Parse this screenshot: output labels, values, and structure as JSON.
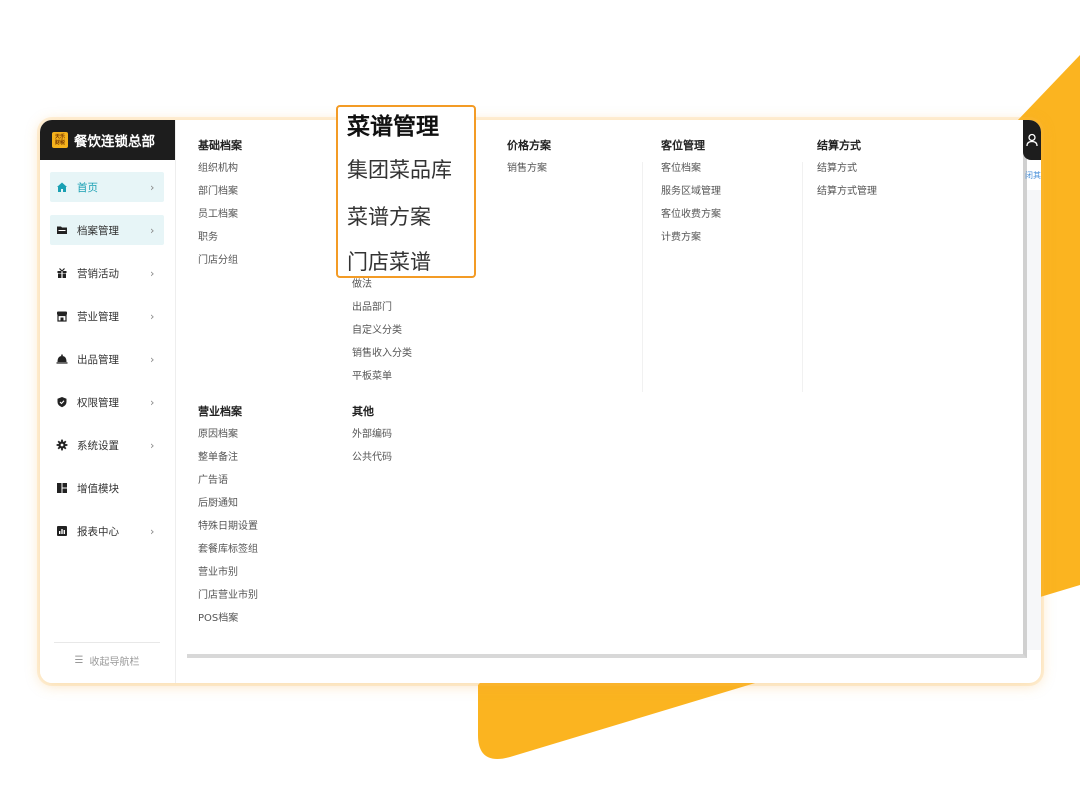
{
  "colors": {
    "accent": "#1aa0b3",
    "brand_bg": "#1d1d1d",
    "background_shape": "#fbb420",
    "highlight_border": "#f39b25"
  },
  "brand": {
    "logo_text": "天乐财税",
    "title": "餐饮连锁总部"
  },
  "sidebar": {
    "items": [
      {
        "label": "首页",
        "icon": "home-icon",
        "arrow": "›"
      },
      {
        "label": "档案管理",
        "icon": "folder-icon",
        "arrow": "›"
      },
      {
        "label": "营销活动",
        "icon": "gift-icon",
        "arrow": "›"
      },
      {
        "label": "营业管理",
        "icon": "store-icon",
        "arrow": "›"
      },
      {
        "label": "出品管理",
        "icon": "cloche-icon",
        "arrow": "›"
      },
      {
        "label": "权限管理",
        "icon": "shield-icon",
        "arrow": "›"
      },
      {
        "label": "系统设置",
        "icon": "gear-icon",
        "arrow": "›"
      },
      {
        "label": "增值模块",
        "icon": "grid-icon",
        "arrow": ""
      },
      {
        "label": "报表中心",
        "icon": "chart-icon",
        "arrow": "›"
      }
    ],
    "collapse_label": "收起导航栏"
  },
  "menu": {
    "basic": {
      "title": "基础档案",
      "items": [
        "组织机构",
        "部门档案",
        "员工档案",
        "职务",
        "门店分组"
      ]
    },
    "recipe": {
      "items": [
        "做法",
        "出品部门",
        "自定义分类",
        "销售收入分类",
        "平板菜单"
      ]
    },
    "price": {
      "title": "价格方案",
      "items": [
        "销售方案"
      ]
    },
    "seat": {
      "title": "客位管理",
      "items": [
        "客位档案",
        "服务区域管理",
        "客位收费方案",
        "计费方案"
      ]
    },
    "settle": {
      "title": "结算方式",
      "items": [
        "结算方式",
        "结算方式管理"
      ]
    },
    "business": {
      "title": "营业档案",
      "items": [
        "原因档案",
        "整单备注",
        "广告语",
        "后厨通知",
        "特殊日期设置",
        "套餐库标签组",
        "营业市别",
        "门店营业市别",
        "POS档案"
      ]
    },
    "other": {
      "title": "其他",
      "items": [
        "外部编码",
        "公共代码"
      ]
    }
  },
  "highlight": {
    "title": "菜谱管理",
    "items": [
      "集团菜品库",
      "菜谱方案",
      "门店菜谱"
    ]
  },
  "top_right": {
    "tab_hint": "闭其"
  }
}
